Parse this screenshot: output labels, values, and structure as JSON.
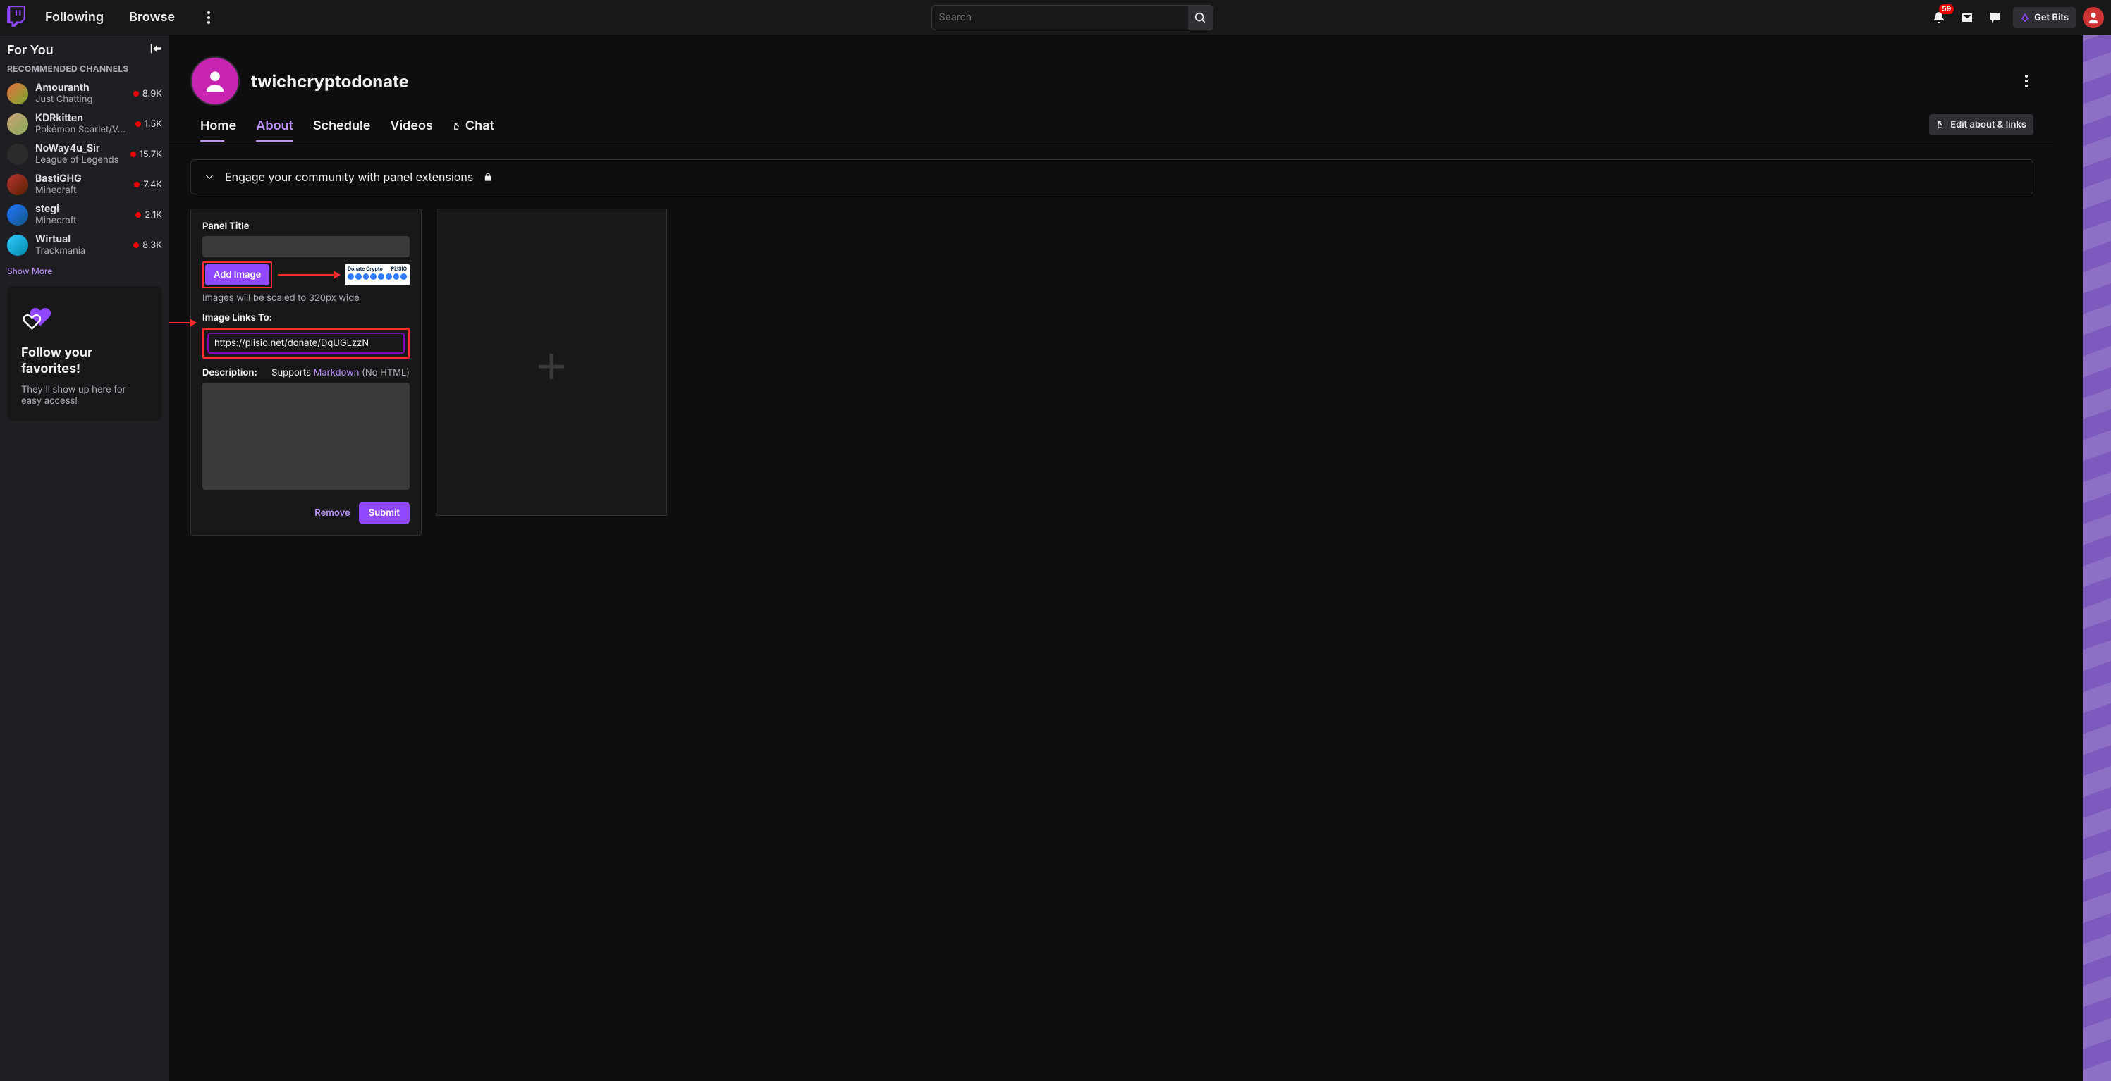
{
  "nav": {
    "following": "Following",
    "browse": "Browse",
    "search_placeholder": "Search",
    "notif_badge": "59",
    "getbits": "Get Bits"
  },
  "sidebar": {
    "title": "For You",
    "section": "RECOMMENDED CHANNELS",
    "show_more": "Show More",
    "channels": [
      {
        "name": "Amouranth",
        "game": "Just Chatting",
        "viewers": "8.9K"
      },
      {
        "name": "KDRkitten",
        "game": "Pokémon Scarlet/V…",
        "viewers": "1.5K"
      },
      {
        "name": "NoWay4u_Sir",
        "game": "League of Legends",
        "viewers": "15.7K"
      },
      {
        "name": "BastiGHG",
        "game": "Minecraft",
        "viewers": "7.4K"
      },
      {
        "name": "stegi",
        "game": "Minecraft",
        "viewers": "2.1K"
      },
      {
        "name": "Wirtual",
        "game": "Trackmania",
        "viewers": "8.3K"
      }
    ],
    "follow_box": {
      "title": "Follow your favorites!",
      "subtitle": "They'll show up here for easy access!"
    }
  },
  "channel": {
    "name": "twichcryptodonate",
    "tabs": {
      "home": "Home",
      "about": "About",
      "schedule": "Schedule",
      "videos": "Videos",
      "chat": "Chat"
    },
    "edit_btn": "Edit about & links",
    "engage": "Engage your community with panel extensions"
  },
  "panel": {
    "title_label": "Panel Title",
    "title_value": "",
    "add_image": "Add Image",
    "donate_txt": "Donate Crypto",
    "plisio_txt": "PLISIO",
    "image_hint": "Images will be scaled to 320px wide",
    "link_label": "Image Links To:",
    "link_value": "https://plisio.net/donate/DqUGLzzN",
    "desc_label": "Description:",
    "supports": "Supports",
    "markdown": "Markdown",
    "nohtml": "(No HTML)",
    "remove": "Remove",
    "submit": "Submit"
  }
}
